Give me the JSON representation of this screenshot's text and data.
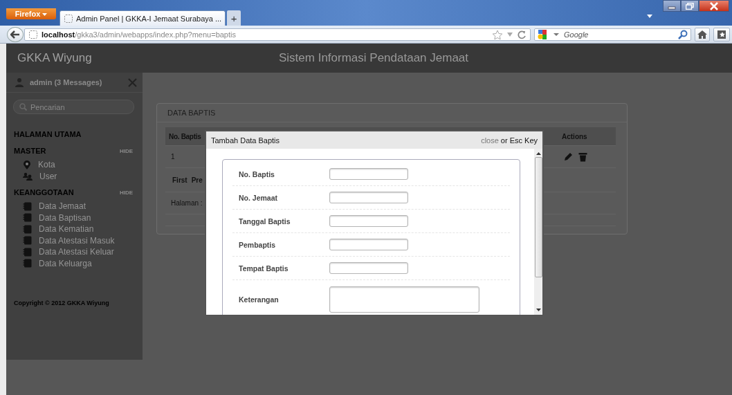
{
  "browser": {
    "app_button": "Firefox",
    "tabs": [
      {
        "title": "Admin Panel | GKKA-I Jemaat Surabaya ...",
        "selected": true
      }
    ],
    "new_tab": "+",
    "url_host": "localhost",
    "url_path": "/gkka3/admin/webapps/index.php?menu=baptis",
    "search_placeholder": "Google"
  },
  "header": {
    "brand": "GKKA Wiyung",
    "title": "Sistem Informasi Pendataan Jemaat"
  },
  "sidebar": {
    "user": "admin (3 Messages)",
    "search_placeholder": "Pencarian",
    "sections": [
      {
        "title": "HALAMAN UTAMA"
      },
      {
        "title": "MASTER",
        "toggle": "HIDE",
        "items": [
          {
            "label": "Kota",
            "kind": "pin"
          },
          {
            "label": "User",
            "kind": "users"
          }
        ]
      },
      {
        "title": "KEANGGOTAAN",
        "toggle": "HIDE",
        "items": [
          {
            "label": "Data Jemaat",
            "kind": "book"
          },
          {
            "label": "Data Baptisan",
            "kind": "book"
          },
          {
            "label": "Data Kematian",
            "kind": "book"
          },
          {
            "label": "Data Atestasi Masuk",
            "kind": "book"
          },
          {
            "label": "Data Atestasi Keluar",
            "kind": "book"
          },
          {
            "label": "Data Keluarga",
            "kind": "book"
          }
        ]
      }
    ],
    "copyright": "Copyright © 2012 GKKA Wiyung"
  },
  "panel": {
    "title": "DATA BAPTIS",
    "columns": [
      "No. Baptis",
      "Actions"
    ],
    "rows": [
      {
        "cells": [
          "1"
        ]
      }
    ],
    "pager": [
      "First",
      "Pre"
    ],
    "page_label": "Halaman :"
  },
  "modal": {
    "title": "Tambah Data Baptis",
    "close_link": "close",
    "close_hint": "or Esc Key",
    "fields": [
      {
        "label": "No. Baptis",
        "kind": "input"
      },
      {
        "label": "No. Jemaat",
        "kind": "input"
      },
      {
        "label": "Tanggal Baptis",
        "kind": "input"
      },
      {
        "label": "Pembaptis",
        "kind": "input"
      },
      {
        "label": "Tempat Baptis",
        "kind": "input"
      },
      {
        "label": "Keterangan",
        "kind": "textarea"
      }
    ]
  }
}
